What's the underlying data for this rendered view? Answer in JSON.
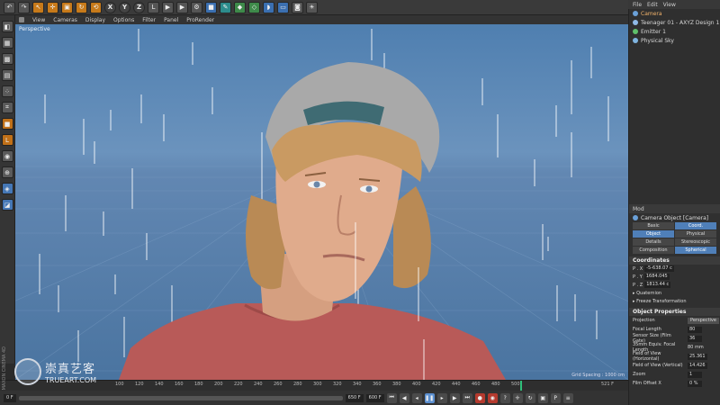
{
  "viewport_menu": [
    "View",
    "Cameras",
    "Display",
    "Options",
    "Filter",
    "Panel",
    "ProRender"
  ],
  "viewport": {
    "label": "Perspective",
    "grid_spacing": "Grid Spacing : 1000 cm"
  },
  "object_manager": {
    "menu": [
      "File",
      "Edit",
      "View"
    ],
    "items": [
      {
        "label": "Camera",
        "selected": true
      },
      {
        "label": "Teenager 01 - AXYZ Design 1",
        "selected": false
      },
      {
        "label": "Emitter 1",
        "selected": false
      },
      {
        "label": "Physical Sky",
        "selected": false
      }
    ]
  },
  "attributes": {
    "mode_label": "Mod",
    "object_title": "Camera Object [Camera]",
    "tabs": [
      {
        "label": "Basic",
        "active": false
      },
      {
        "label": "Coord.",
        "active": true
      },
      {
        "label": "Object",
        "active": true
      },
      {
        "label": "Physical",
        "active": false
      },
      {
        "label": "Details",
        "active": false
      },
      {
        "label": "Stereoscopic",
        "active": false
      },
      {
        "label": "Composition",
        "active": false
      },
      {
        "label": "Spherical",
        "active": true
      }
    ],
    "coordinates_title": "Coordinates",
    "coords": [
      {
        "axis": "P . X",
        "value": "-5-638.07 c"
      },
      {
        "axis": "P . Y",
        "value": "1684.045"
      },
      {
        "axis": "P . Z",
        "value": "1813.44 c"
      }
    ],
    "collapsed_groups": [
      "Quaternion",
      "Freeze Transformation"
    ],
    "object_properties_title": "Object Properties",
    "properties": [
      {
        "label": "Projection",
        "value": "Perspective",
        "type": "dropdown"
      },
      {
        "label": "Focal Length",
        "value": "80",
        "type": "field"
      },
      {
        "label": "Sensor Size (Film Gate)",
        "value": "36",
        "type": "field"
      },
      {
        "label": "35mm Equiv. Focal Length",
        "value": "80 mm",
        "type": "text"
      },
      {
        "label": "Field of View (Horizontal)",
        "value": "25.361",
        "type": "field"
      },
      {
        "label": "Field of View (Vertical)",
        "value": "14.426",
        "type": "field"
      },
      {
        "label": "Zoom",
        "value": "1",
        "type": "field"
      },
      {
        "label": "Film Offset X",
        "value": "0 %",
        "type": "field"
      }
    ]
  },
  "timeline": {
    "ticks": [
      "100",
      "120",
      "140",
      "160",
      "180",
      "200",
      "220",
      "240",
      "260",
      "280",
      "300",
      "320",
      "340",
      "360",
      "380",
      "400",
      "420",
      "440",
      "460",
      "480",
      "500"
    ],
    "current_frame": "521 F"
  },
  "transport": {
    "start": "0 F",
    "end": "650 F",
    "range_end": "600 F"
  },
  "watermark": {
    "cn": "崇真艺客",
    "en": "TRUEART.COM"
  },
  "side_text": "MAXON CINEMA 4D",
  "colors": {
    "accent": "#4f7fb8",
    "selected_text": "#f2b36b",
    "playhead": "#2fbf7a",
    "viewport_sky": "#6b93bd"
  }
}
